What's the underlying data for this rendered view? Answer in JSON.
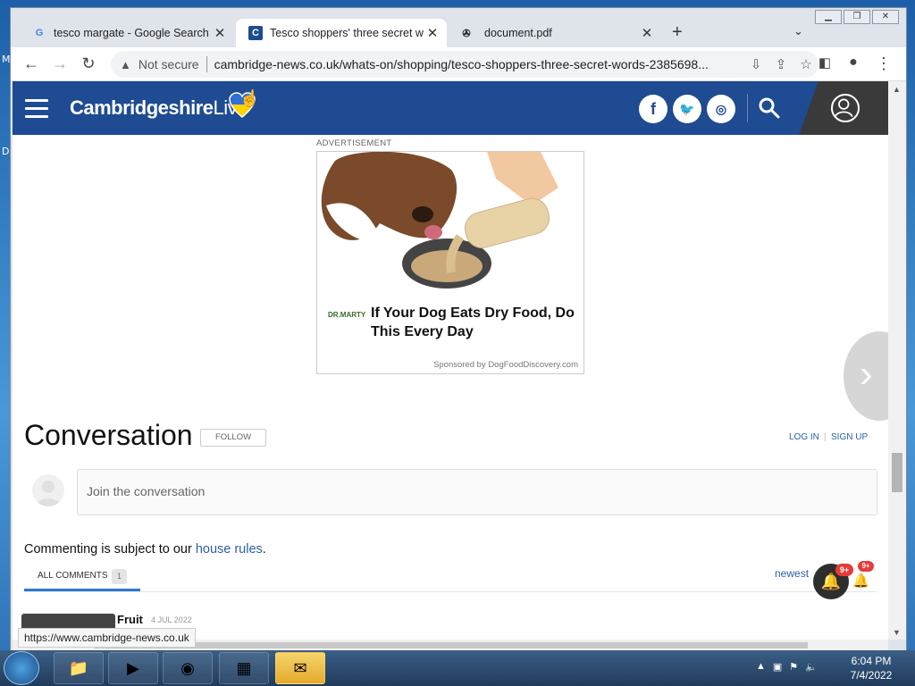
{
  "browser": {
    "tabs": [
      {
        "label": "tesco margate - Google Search",
        "favicon": "G",
        "active": false
      },
      {
        "label": "Tesco shoppers' three secret wor",
        "favicon": "C",
        "active": true
      },
      {
        "label": "document.pdf",
        "favicon": "pdf-icon",
        "active": false
      }
    ],
    "newtab_label": "+",
    "security_label": "Not secure",
    "url": "cambridge-news.co.uk/whats-on/shopping/tesco-shoppers-three-secret-words-2385698...",
    "status_url": "https://www.cambridge-news.co.uk"
  },
  "site": {
    "logo_bold": "Cambridgeshire",
    "logo_light": "Live",
    "social": [
      "f",
      "t",
      "ig"
    ],
    "brand_color": "#1e4b91"
  },
  "ad": {
    "label": "ADVERTISEMENT",
    "brand": "DR.MARTY",
    "headline": "If Your Dog Eats Dry Food, Do This Every Day",
    "sponsor": "Sponsored by DogFoodDiscovery.com"
  },
  "conversation": {
    "title": "Conversation",
    "follow_label": "FOLLOW",
    "login_label": "LOG IN",
    "signup_label": "SIGN UP",
    "join_placeholder": "Join the conversation",
    "rules_prefix": "Commenting is subject to our ",
    "rules_link": "house rules",
    "rules_suffix": ".",
    "all_comments_label": "ALL COMMENTS",
    "comment_count": "1",
    "sort_label": "newest",
    "notif_badge": "9+",
    "notif_badge2": "9+",
    "first_comment_name": "Fruit",
    "first_comment_date": "4 JUL 2022"
  },
  "taskbar": {
    "time": "6:04 PM",
    "date": "7/4/2022"
  },
  "desktop": {
    "letters": [
      "M",
      "D"
    ]
  }
}
